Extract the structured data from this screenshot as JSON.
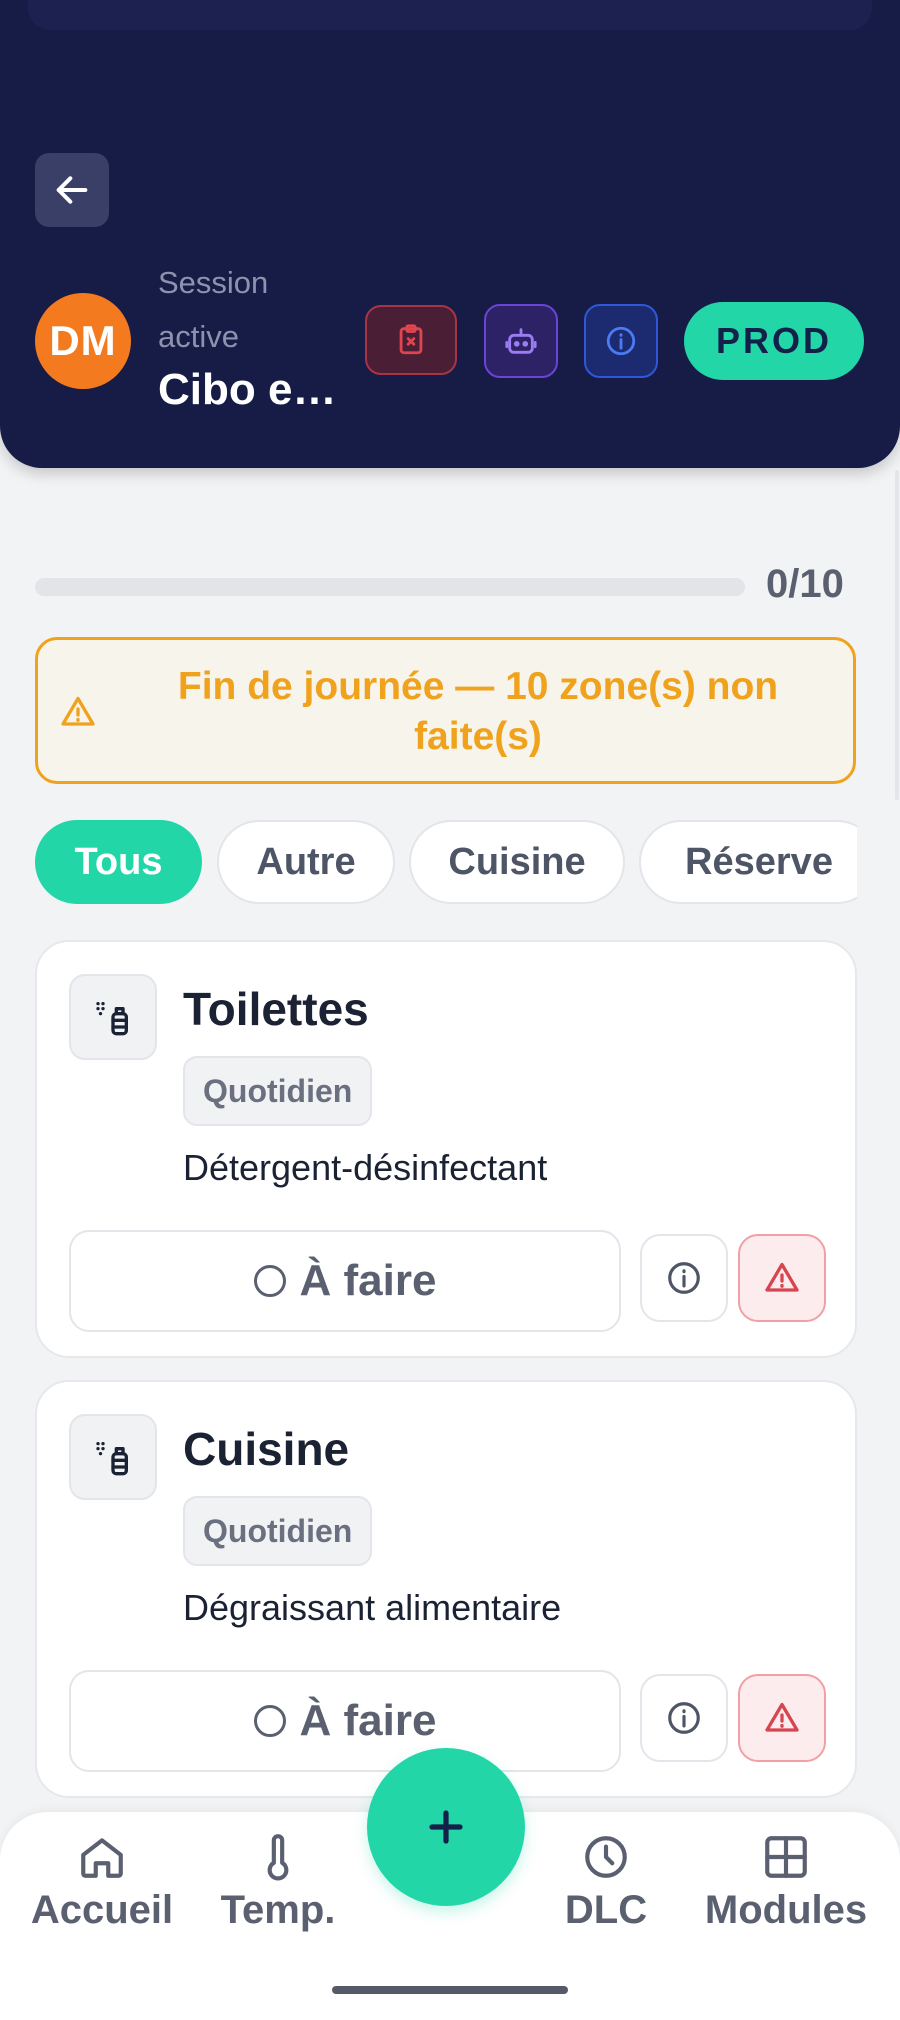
{
  "header": {
    "session_label": "Session active",
    "session_name": "Cibo e…",
    "avatar_initials": "DM",
    "env_badge": "PROD",
    "icons": [
      "back-arrow-icon",
      "clipboard-x-icon",
      "robot-icon",
      "info-icon"
    ]
  },
  "progress": {
    "done": 0,
    "total": 10,
    "label": "0/10"
  },
  "alert": {
    "text": "Fin de journée — 10 zone(s) non faite(s)",
    "icon": "warning-triangle-icon"
  },
  "filters": [
    "Tous",
    "Autre",
    "Cuisine",
    "Réserve"
  ],
  "active_filter": "Tous",
  "cards": [
    {
      "title": "Toilettes",
      "frequency": "Quotidien",
      "product": "Détergent-désinfectant",
      "status": "À faire",
      "icon": "spray-bottle-icon"
    },
    {
      "title": "Cuisine",
      "frequency": "Quotidien",
      "product": "Dégraissant alimentaire",
      "status": "À faire",
      "icon": "spray-bottle-icon"
    }
  ],
  "nav": {
    "home": "Accueil",
    "temp": "Temp.",
    "dlc": "DLC",
    "modules": "Modules",
    "fab_icon": "plus-icon"
  },
  "colors": {
    "header_bg": "#171c46",
    "accent": "#22d6a7",
    "warning": "#f0a21c",
    "danger": "#d64550",
    "avatar": "#f47a1f"
  }
}
